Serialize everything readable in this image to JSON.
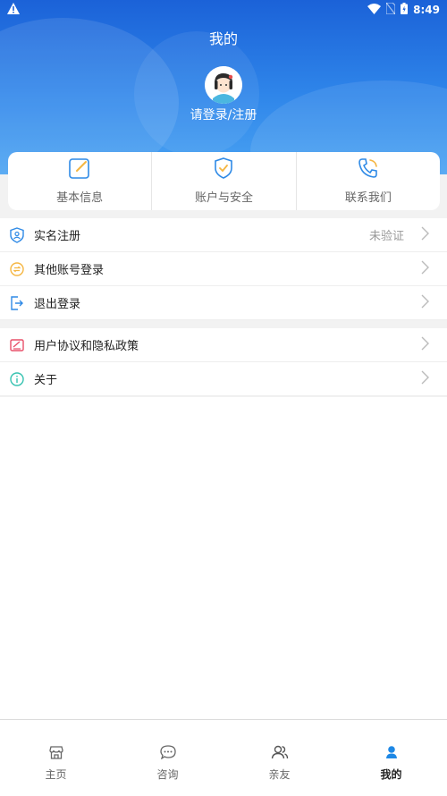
{
  "status_bar": {
    "time": "8:49"
  },
  "header": {
    "title": "我的",
    "login_text": "请登录/注册"
  },
  "quick_actions": [
    {
      "label": "基本信息",
      "icon": "edit-icon"
    },
    {
      "label": "账户与安全",
      "icon": "shield-icon"
    },
    {
      "label": "联系我们",
      "icon": "phone-icon"
    }
  ],
  "account_section": [
    {
      "label": "实名注册",
      "status": "未验证",
      "icon": "id-shield-icon"
    },
    {
      "label": "其他账号登录",
      "icon": "switch-account-icon"
    },
    {
      "label": "退出登录",
      "icon": "logout-icon"
    }
  ],
  "info_section": [
    {
      "label": "用户协议和隐私政策",
      "icon": "agreement-icon"
    },
    {
      "label": "关于",
      "icon": "info-icon"
    }
  ],
  "tabbar": [
    {
      "label": "主页",
      "icon": "home-icon"
    },
    {
      "label": "咨询",
      "icon": "chat-icon"
    },
    {
      "label": "亲友",
      "icon": "friends-icon"
    },
    {
      "label": "我的",
      "icon": "user-icon",
      "active": true
    }
  ],
  "colors": {
    "header_top": "#1b62d8",
    "header_bottom": "#4aa3f2",
    "accent": "#1e88e5"
  }
}
